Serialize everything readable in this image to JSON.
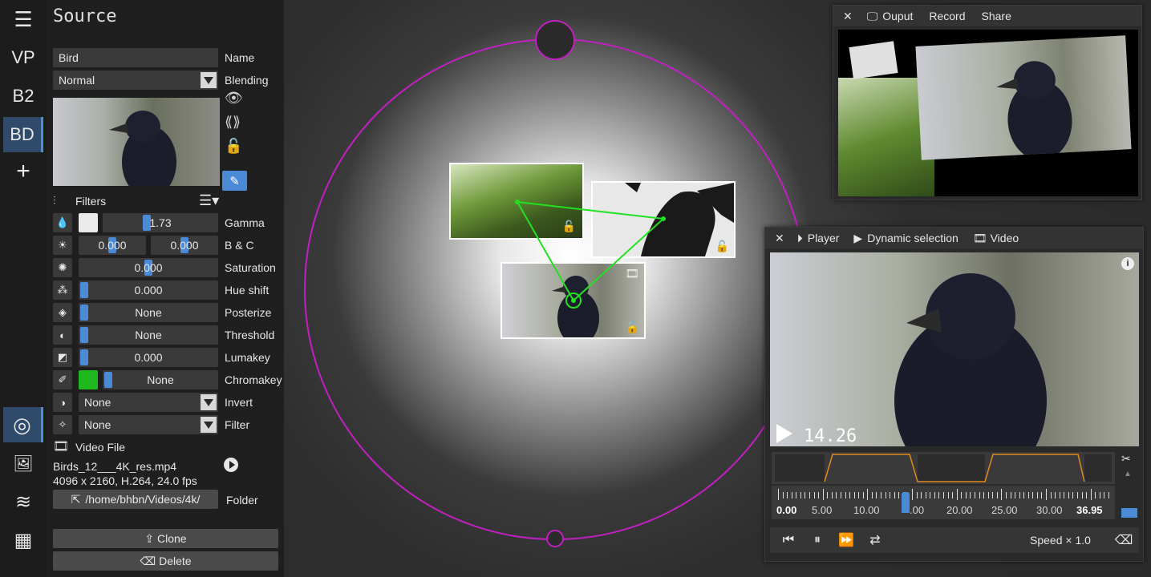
{
  "iconbar": {
    "items": [
      {
        "label": "☰",
        "name": "menu"
      },
      {
        "label": "VP",
        "name": "vp"
      },
      {
        "label": "B2",
        "name": "b2"
      },
      {
        "label": "BD",
        "name": "bd"
      },
      {
        "label": "+",
        "name": "add"
      }
    ],
    "bottom": [
      {
        "label": "◎",
        "name": "target"
      },
      {
        "label": "🖼",
        "name": "images"
      },
      {
        "label": "≋",
        "name": "layers"
      },
      {
        "label": "▦",
        "name": "checker"
      }
    ]
  },
  "source": {
    "title": "Source",
    "name_value": "Bird",
    "name_label": "Name",
    "blending_value": "Normal",
    "blending_label": "Blending",
    "filters_label": "Filters",
    "gamma_value": "1.73",
    "gamma_label": "Gamma",
    "bc_value1": "0.000",
    "bc_value2": "0.000",
    "bc_label": "B & C",
    "saturation_value": "0.000",
    "saturation_label": "Saturation",
    "hue_value": "0.000",
    "hue_label": "Hue shift",
    "posterize_value": "None",
    "posterize_label": "Posterize",
    "threshold_value": "None",
    "threshold_label": "Threshold",
    "lumakey_value": "0.000",
    "lumakey_label": "Lumakey",
    "chromakey_value": "None",
    "chromakey_label": "Chromakey",
    "invert_value": "None",
    "invert_label": "Invert",
    "filter_value": "None",
    "filter_label": "Filter",
    "video_file_label": "Video File",
    "file_name": "Birds_12___4K_res.mp4",
    "file_info": "4096 x 2160, H.264, 24.0 fps",
    "folder_path": "/home/bhbn/Videos/4k/",
    "folder_label": "Folder",
    "clone_label": "Clone",
    "delete_label": "Delete"
  },
  "output_window": {
    "title": "Ouput",
    "record": "Record",
    "share": "Share"
  },
  "player_window": {
    "player": "Player",
    "dynamic": "Dynamic selection",
    "video": "Video",
    "time": "14.26",
    "speed": "Speed × 1.0",
    "timeline_labels": [
      "0.00",
      "5.00",
      "10.00",
      ".00",
      "20.00",
      "25.00",
      "30.00",
      "36.95"
    ],
    "timeline_max": 36.95,
    "position": 14.26
  }
}
